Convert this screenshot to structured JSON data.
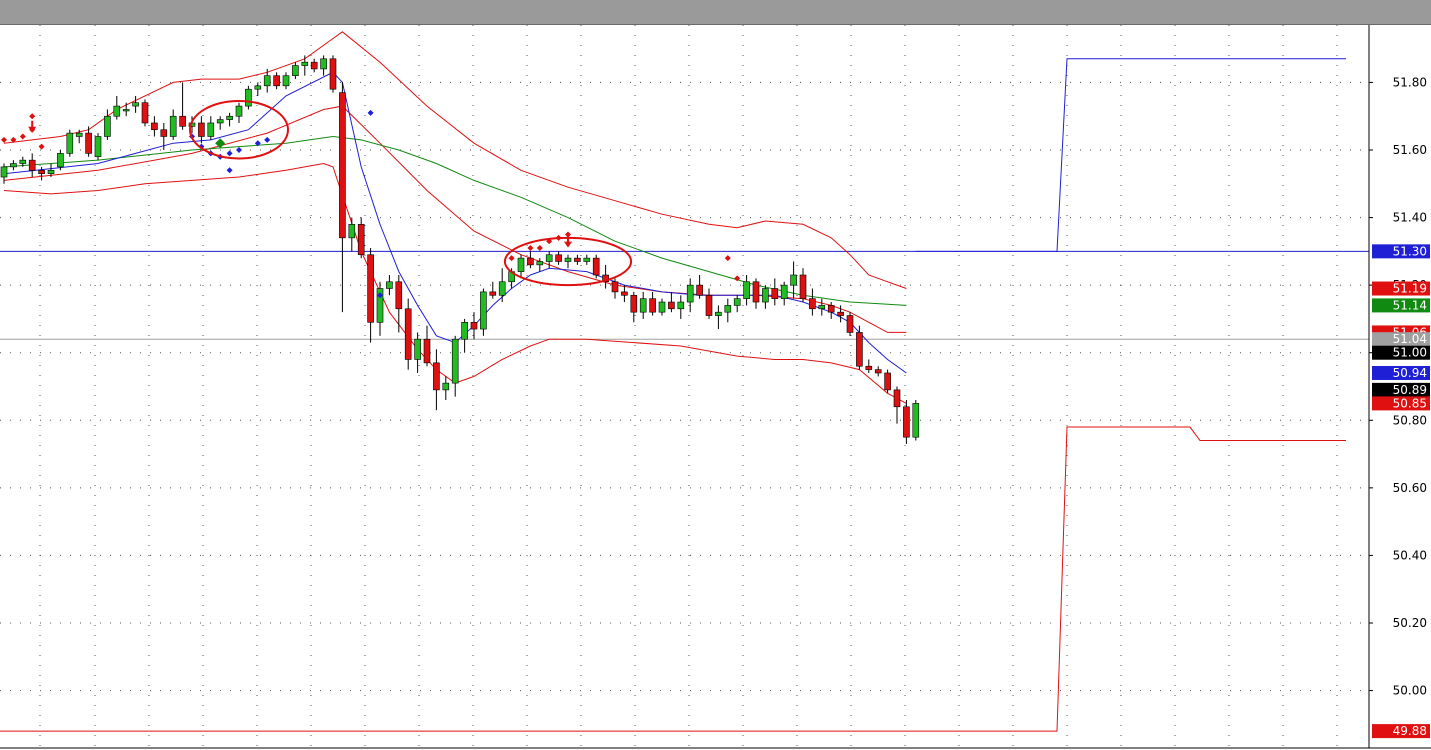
{
  "chart_data": {
    "type": "candlestick",
    "title": "",
    "xlabel": "",
    "ylabel": "",
    "ylim": [
      49.83,
      51.97
    ],
    "grid": true,
    "y_ticks": [
      "51.80",
      "51.60",
      "51.40",
      "51.20",
      "51.00",
      "50.80",
      "50.60",
      "50.40",
      "50.20",
      "50.00"
    ],
    "price_flags": [
      {
        "label": "51.30",
        "value": 51.3,
        "color": "#1f1fd6"
      },
      {
        "label": "51.19",
        "value": 51.19,
        "color": "#e01010"
      },
      {
        "label": "51.14",
        "value": 51.14,
        "color": "#108a10"
      },
      {
        "label": "51.06",
        "value": 51.06,
        "color": "#e01010"
      },
      {
        "label": "51.04",
        "value": 51.04,
        "color": "#a0a0a0"
      },
      {
        "label": "51.00",
        "value": 51.0,
        "color": "#000000"
      },
      {
        "label": "50.94",
        "value": 50.94,
        "color": "#1f1fd6"
      },
      {
        "label": "50.89",
        "value": 50.89,
        "color": "#000000"
      },
      {
        "label": "50.85",
        "value": 50.85,
        "color": "#e01010"
      },
      {
        "label": "49.88",
        "value": 49.88,
        "color": "#e01010"
      }
    ],
    "candles": [
      [
        51.52,
        51.56,
        51.5,
        51.55
      ],
      [
        51.55,
        51.57,
        51.54,
        51.56
      ],
      [
        51.56,
        51.58,
        51.55,
        51.57
      ],
      [
        51.57,
        51.59,
        51.52,
        51.54
      ],
      [
        51.54,
        51.55,
        51.51,
        51.53
      ],
      [
        51.53,
        51.56,
        51.52,
        51.54
      ],
      [
        51.55,
        51.6,
        51.54,
        51.59
      ],
      [
        51.59,
        51.66,
        51.58,
        51.65
      ],
      [
        51.64,
        51.66,
        51.62,
        51.65
      ],
      [
        51.65,
        51.67,
        51.58,
        51.59
      ],
      [
        51.58,
        51.65,
        51.57,
        51.64
      ],
      [
        51.64,
        51.72,
        51.63,
        51.7
      ],
      [
        51.7,
        51.76,
        51.69,
        51.73
      ],
      [
        51.72,
        51.74,
        51.7,
        51.72
      ],
      [
        51.73,
        51.76,
        51.71,
        51.74
      ],
      [
        51.74,
        51.75,
        51.67,
        51.68
      ],
      [
        51.68,
        51.7,
        51.64,
        51.66
      ],
      [
        51.66,
        51.68,
        51.6,
        51.64
      ],
      [
        51.64,
        51.72,
        51.63,
        51.7
      ],
      [
        51.7,
        51.8,
        51.66,
        51.67
      ],
      [
        51.67,
        51.7,
        51.65,
        51.68
      ],
      [
        51.68,
        51.7,
        51.62,
        51.64
      ],
      [
        51.64,
        51.7,
        51.63,
        51.68
      ],
      [
        51.68,
        51.7,
        51.66,
        51.69
      ],
      [
        51.69,
        51.71,
        51.67,
        51.7
      ],
      [
        51.7,
        51.74,
        51.68,
        51.73
      ],
      [
        51.73,
        51.79,
        51.72,
        51.78
      ],
      [
        51.78,
        51.8,
        51.76,
        51.79
      ],
      [
        51.79,
        51.84,
        51.77,
        51.82
      ],
      [
        51.82,
        51.83,
        51.78,
        51.79
      ],
      [
        51.79,
        51.83,
        51.78,
        51.82
      ],
      [
        51.82,
        51.86,
        51.81,
        51.85
      ],
      [
        51.85,
        51.88,
        51.82,
        51.86
      ],
      [
        51.86,
        51.87,
        51.83,
        51.84
      ],
      [
        51.84,
        51.88,
        51.82,
        51.87
      ],
      [
        51.87,
        51.88,
        51.77,
        51.78
      ],
      [
        51.77,
        51.8,
        51.12,
        51.34
      ],
      [
        51.34,
        51.4,
        51.3,
        51.38
      ],
      [
        51.38,
        51.4,
        51.28,
        51.29
      ],
      [
        51.29,
        51.31,
        51.03,
        51.09
      ],
      [
        51.09,
        51.21,
        51.05,
        51.19
      ],
      [
        51.19,
        51.23,
        51.17,
        51.21
      ],
      [
        51.21,
        51.23,
        51.06,
        51.13
      ],
      [
        51.13,
        51.16,
        50.95,
        50.98
      ],
      [
        50.98,
        51.06,
        50.94,
        51.04
      ],
      [
        51.04,
        51.08,
        50.96,
        50.97
      ],
      [
        50.97,
        51.01,
        50.83,
        50.89
      ],
      [
        50.89,
        50.93,
        50.86,
        50.91
      ],
      [
        50.91,
        51.05,
        50.87,
        51.04
      ],
      [
        51.04,
        51.1,
        51.0,
        51.09
      ],
      [
        51.09,
        51.12,
        51.04,
        51.07
      ],
      [
        51.07,
        51.19,
        51.05,
        51.18
      ],
      [
        51.18,
        51.21,
        51.16,
        51.17
      ],
      [
        51.17,
        51.25,
        51.15,
        51.21
      ],
      [
        51.21,
        51.25,
        51.19,
        51.24
      ],
      [
        51.24,
        51.29,
        51.22,
        51.28
      ],
      [
        51.28,
        51.3,
        51.25,
        51.26
      ],
      [
        51.26,
        51.28,
        51.24,
        51.27
      ],
      [
        51.27,
        51.3,
        51.25,
        51.29
      ],
      [
        51.29,
        51.3,
        51.26,
        51.27
      ],
      [
        51.27,
        51.29,
        51.25,
        51.28
      ],
      [
        51.28,
        51.29,
        51.26,
        51.27
      ],
      [
        51.27,
        51.29,
        51.26,
        51.28
      ],
      [
        51.28,
        51.29,
        51.22,
        51.23
      ],
      [
        51.23,
        51.26,
        51.19,
        51.21
      ],
      [
        51.21,
        51.22,
        51.16,
        51.18
      ],
      [
        51.18,
        51.2,
        51.15,
        51.17
      ],
      [
        51.17,
        51.18,
        51.09,
        51.12
      ],
      [
        51.12,
        51.18,
        51.1,
        51.16
      ],
      [
        51.16,
        51.18,
        51.11,
        51.12
      ],
      [
        51.12,
        51.16,
        51.11,
        51.15
      ],
      [
        51.15,
        51.18,
        51.12,
        51.13
      ],
      [
        51.13,
        51.17,
        51.1,
        51.15
      ],
      [
        51.15,
        51.22,
        51.12,
        51.2
      ],
      [
        51.2,
        51.23,
        51.16,
        51.17
      ],
      [
        51.17,
        51.19,
        51.1,
        51.11
      ],
      [
        51.11,
        51.14,
        51.07,
        51.12
      ],
      [
        51.12,
        51.16,
        51.09,
        51.14
      ],
      [
        51.14,
        51.17,
        51.12,
        51.16
      ],
      [
        51.16,
        51.23,
        51.14,
        51.21
      ],
      [
        51.21,
        51.22,
        51.13,
        51.15
      ],
      [
        51.15,
        51.2,
        51.13,
        51.19
      ],
      [
        51.19,
        51.22,
        51.14,
        51.16
      ],
      [
        51.16,
        51.21,
        51.14,
        51.2
      ],
      [
        51.2,
        51.27,
        51.16,
        51.23
      ],
      [
        51.23,
        51.25,
        51.15,
        51.16
      ],
      [
        51.16,
        51.19,
        51.11,
        51.13
      ],
      [
        51.13,
        51.16,
        51.11,
        51.14
      ],
      [
        51.14,
        51.15,
        51.1,
        51.12
      ],
      [
        51.12,
        51.14,
        51.09,
        51.11
      ],
      [
        51.11,
        51.12,
        51.05,
        51.06
      ],
      [
        51.06,
        51.08,
        50.95,
        50.96
      ],
      [
        50.96,
        50.98,
        50.94,
        50.95
      ],
      [
        50.95,
        50.96,
        50.93,
        50.94
      ],
      [
        50.94,
        50.95,
        50.88,
        50.89
      ],
      [
        50.89,
        50.9,
        50.79,
        50.84
      ],
      [
        50.84,
        50.86,
        50.73,
        50.75
      ],
      [
        50.75,
        50.86,
        50.74,
        50.85
      ]
    ],
    "upper_band": [
      [
        0,
        51.62
      ],
      [
        3,
        51.63
      ],
      [
        6,
        51.64
      ],
      [
        9,
        51.66
      ],
      [
        12,
        51.72
      ],
      [
        15,
        51.76
      ],
      [
        18,
        51.8
      ],
      [
        21,
        51.81
      ],
      [
        25,
        51.81
      ],
      [
        28,
        51.83
      ],
      [
        32,
        51.87
      ],
      [
        35,
        51.93
      ],
      [
        36,
        51.95
      ],
      [
        40,
        51.86
      ],
      [
        45,
        51.73
      ],
      [
        50,
        51.62
      ],
      [
        55,
        51.54
      ],
      [
        60,
        51.49
      ],
      [
        65,
        51.45
      ],
      [
        70,
        51.41
      ],
      [
        75,
        51.38
      ],
      [
        78,
        51.37
      ],
      [
        81,
        51.39
      ],
      [
        85,
        51.38
      ],
      [
        88,
        51.34
      ],
      [
        90,
        51.29
      ],
      [
        92,
        51.23
      ],
      [
        94,
        51.21
      ],
      [
        96,
        51.19
      ]
    ],
    "lower_band": [
      [
        0,
        51.48
      ],
      [
        5,
        51.47
      ],
      [
        10,
        51.48
      ],
      [
        15,
        51.5
      ],
      [
        20,
        51.51
      ],
      [
        25,
        51.52
      ],
      [
        30,
        51.54
      ],
      [
        34,
        51.56
      ],
      [
        35,
        51.55
      ],
      [
        38,
        51.3
      ],
      [
        41,
        51.12
      ],
      [
        44,
        51.01
      ],
      [
        46,
        50.95
      ],
      [
        48,
        50.91
      ],
      [
        50,
        50.93
      ],
      [
        53,
        50.98
      ],
      [
        56,
        51.02
      ],
      [
        58,
        51.04
      ],
      [
        62,
        51.04
      ],
      [
        67,
        51.03
      ],
      [
        72,
        51.02
      ],
      [
        78,
        50.99
      ],
      [
        82,
        50.98
      ],
      [
        85,
        50.98
      ],
      [
        88,
        50.97
      ],
      [
        91,
        50.95
      ],
      [
        94,
        50.88
      ],
      [
        96,
        50.85
      ]
    ],
    "mid_red": [
      [
        0,
        51.51
      ],
      [
        10,
        51.54
      ],
      [
        20,
        51.59
      ],
      [
        28,
        51.65
      ],
      [
        34,
        51.72
      ],
      [
        36,
        51.73
      ],
      [
        40,
        51.62
      ],
      [
        45,
        51.48
      ],
      [
        50,
        51.36
      ],
      [
        55,
        51.29
      ],
      [
        60,
        51.24
      ],
      [
        65,
        51.2
      ],
      [
        70,
        51.18
      ],
      [
        75,
        51.17
      ],
      [
        80,
        51.17
      ],
      [
        85,
        51.16
      ],
      [
        88,
        51.14
      ],
      [
        90,
        51.12
      ],
      [
        92,
        51.09
      ],
      [
        94,
        51.06
      ],
      [
        96,
        51.06
      ]
    ],
    "mid_blue": [
      [
        0,
        51.53
      ],
      [
        10,
        51.56
      ],
      [
        18,
        51.62
      ],
      [
        22,
        51.63
      ],
      [
        26,
        51.66
      ],
      [
        30,
        51.76
      ],
      [
        35,
        51.83
      ],
      [
        36,
        51.8
      ],
      [
        38,
        51.55
      ],
      [
        40,
        51.38
      ],
      [
        42,
        51.24
      ],
      [
        44,
        51.14
      ],
      [
        46,
        51.05
      ],
      [
        48,
        51.03
      ],
      [
        50,
        51.08
      ],
      [
        52,
        51.14
      ],
      [
        54,
        51.19
      ],
      [
        56,
        51.23
      ],
      [
        58,
        51.25
      ],
      [
        62,
        51.24
      ],
      [
        66,
        51.2
      ],
      [
        70,
        51.18
      ],
      [
        74,
        51.17
      ],
      [
        78,
        51.17
      ],
      [
        82,
        51.17
      ],
      [
        85,
        51.15
      ],
      [
        88,
        51.12
      ],
      [
        90,
        51.09
      ],
      [
        92,
        51.03
      ],
      [
        94,
        50.98
      ],
      [
        96,
        50.94
      ]
    ],
    "green_ma": [
      [
        0,
        51.55
      ],
      [
        10,
        51.57
      ],
      [
        20,
        51.6
      ],
      [
        30,
        51.62
      ],
      [
        35,
        51.64
      ],
      [
        38,
        51.63
      ],
      [
        42,
        51.6
      ],
      [
        46,
        51.56
      ],
      [
        50,
        51.51
      ],
      [
        55,
        51.46
      ],
      [
        60,
        51.4
      ],
      [
        65,
        51.33
      ],
      [
        70,
        51.28
      ],
      [
        75,
        51.24
      ],
      [
        80,
        51.2
      ],
      [
        85,
        51.17
      ],
      [
        90,
        51.15
      ],
      [
        96,
        51.14
      ]
    ],
    "markers": [
      {
        "index": 0,
        "value": 51.63,
        "color": "red"
      },
      {
        "index": 1,
        "value": 51.63,
        "color": "red"
      },
      {
        "index": 2,
        "value": 51.64,
        "color": "red"
      },
      {
        "index": 3,
        "value": 51.66,
        "color": "red"
      },
      {
        "index": 3,
        "value": 51.7,
        "color": "red"
      },
      {
        "index": 4,
        "value": 51.61,
        "color": "red"
      },
      {
        "index": 20,
        "value": 51.64,
        "color": "blue"
      },
      {
        "index": 21,
        "value": 51.61,
        "color": "blue"
      },
      {
        "index": 22,
        "value": 51.59,
        "color": "blue"
      },
      {
        "index": 23,
        "value": 51.58,
        "color": "blue"
      },
      {
        "index": 24,
        "value": 51.59,
        "color": "blue"
      },
      {
        "index": 24,
        "value": 51.54,
        "color": "blue"
      },
      {
        "index": 25,
        "value": 51.6,
        "color": "blue"
      },
      {
        "index": 27,
        "value": 51.62,
        "color": "blue"
      },
      {
        "index": 28,
        "value": 51.63,
        "color": "blue"
      },
      {
        "index": 23,
        "value": 51.62,
        "color": "green"
      },
      {
        "index": 39,
        "value": 51.71,
        "color": "blue"
      },
      {
        "index": 40,
        "value": 51.17,
        "color": "blue"
      },
      {
        "index": 54,
        "value": 51.28,
        "color": "red"
      },
      {
        "index": 56,
        "value": 51.31,
        "color": "red"
      },
      {
        "index": 57,
        "value": 51.31,
        "color": "red"
      },
      {
        "index": 58,
        "value": 51.33,
        "color": "red"
      },
      {
        "index": 59,
        "value": 51.34,
        "color": "red"
      },
      {
        "index": 60,
        "value": 51.35,
        "color": "red"
      },
      {
        "index": 77,
        "value": 51.28,
        "color": "red"
      },
      {
        "index": 78,
        "value": 51.22,
        "color": "red"
      }
    ],
    "arrows": [
      {
        "index": 3,
        "value": 51.66
      },
      {
        "index": 60,
        "value": 51.32
      }
    ],
    "circles": [
      {
        "center_index": 25,
        "center_value": 51.66,
        "index_span": 10,
        "value_span": 0.17
      },
      {
        "center_index": 60,
        "center_value": 51.27,
        "index_span": 13,
        "value_span": 0.14
      }
    ],
    "h_lines": [
      {
        "value": 51.3,
        "color": "blue"
      },
      {
        "value": 51.04,
        "color": "gray"
      }
    ],
    "projection_blue": {
      "start_value": 51.3,
      "end_value": 51.87
    },
    "projection_red": {
      "start_value": 49.88,
      "plateau_value": 50.78,
      "end_value": 50.74
    }
  }
}
